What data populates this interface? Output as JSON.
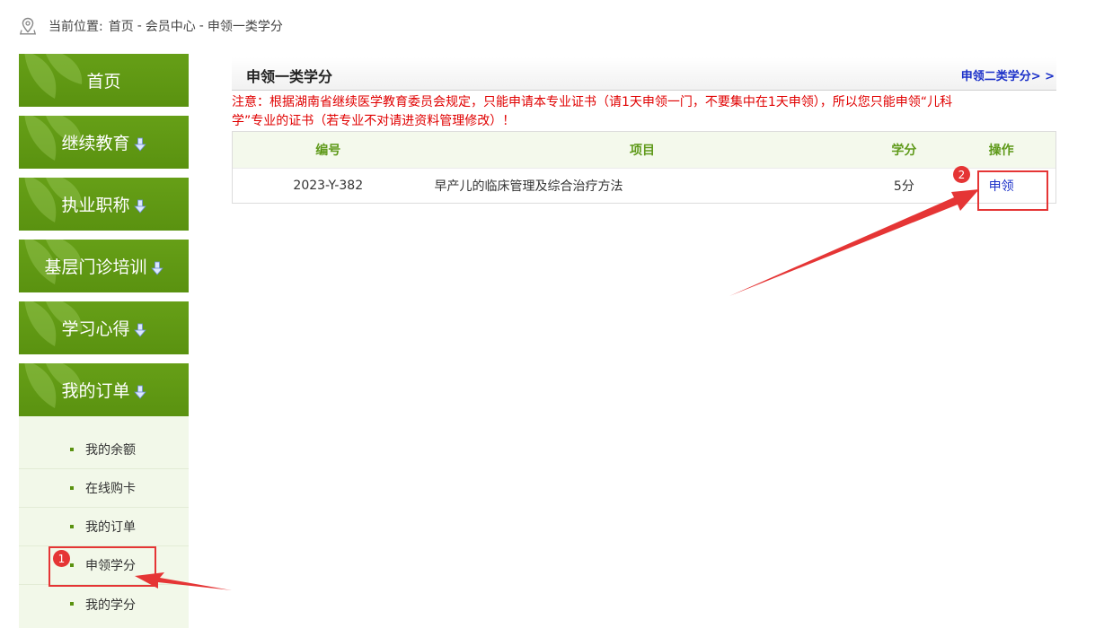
{
  "breadcrumb": {
    "prefix": "当前位置:",
    "items": [
      "首页",
      "会员中心",
      "申领一类学分"
    ],
    "separator": "-"
  },
  "sidebar": {
    "main_items": [
      {
        "label": "首页",
        "has_arrow": false
      },
      {
        "label": "继续教育",
        "has_arrow": true
      },
      {
        "label": "执业职称",
        "has_arrow": true
      },
      {
        "label": "基层门诊培训",
        "has_arrow": true
      },
      {
        "label": "学习心得",
        "has_arrow": true
      },
      {
        "label": "我的订单",
        "has_arrow": true
      }
    ],
    "sub_items": [
      "我的余额",
      "在线购卡",
      "我的订单",
      "申领学分",
      "我的学分"
    ]
  },
  "panel": {
    "title": "申领一类学分",
    "link": "申领二类学分> >",
    "notice": "注意：根据湖南省继续医学教育委员会规定，只能申请本专业证书（请1天申领一门，不要集中在1天申领），所以您只能申领“儿科学”专业的证书（若专业不对请进资料管理修改）！"
  },
  "table": {
    "headers": [
      "编号",
      "项目",
      "学分",
      "操作"
    ],
    "rows": [
      {
        "code": "2023-Y-382",
        "project": "早产儿的临床管理及综合治疗方法",
        "credit": "5分",
        "action": "申领"
      }
    ]
  },
  "annotations": {
    "badge1": "1",
    "badge2": "2"
  },
  "colors": {
    "sidebar_green": "#5f9a16",
    "header_green": "#5f9a1a",
    "notice_red": "#e00000",
    "link_blue": "#1b30c8",
    "annotation_red": "#e53535"
  }
}
